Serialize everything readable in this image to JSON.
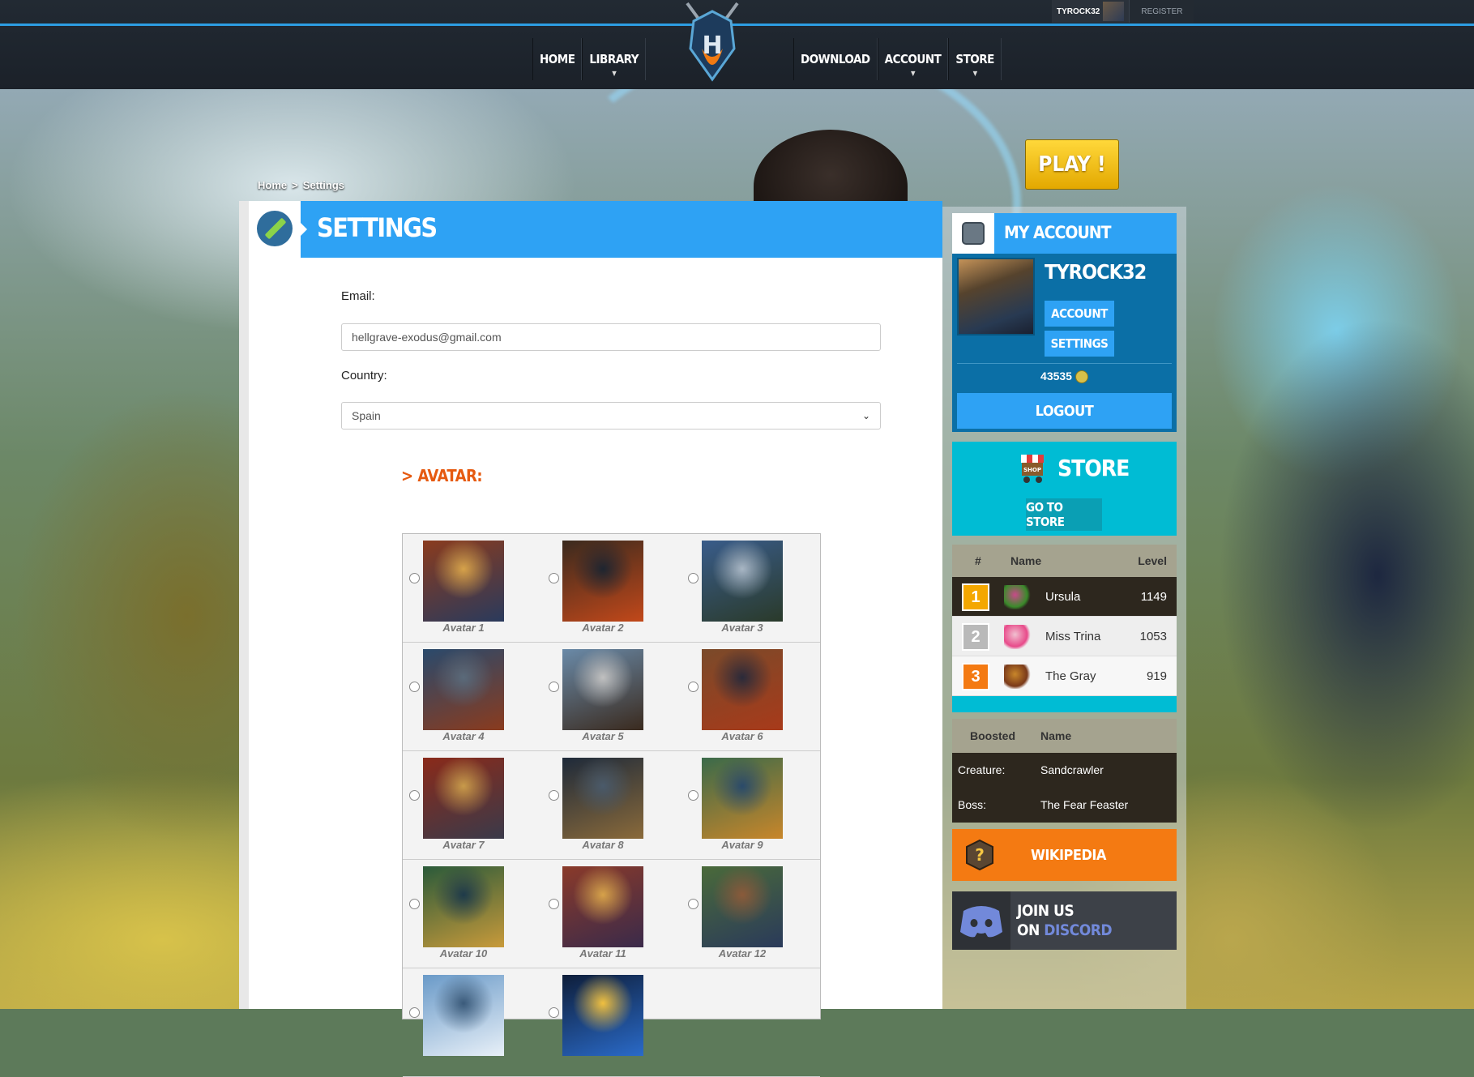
{
  "header": {
    "username": "TYROCK32",
    "register": "REGISTER",
    "nav_left": [
      "HOME",
      "LIBRARY"
    ],
    "nav_right": [
      "DOWNLOAD",
      "ACCOUNT",
      "STORE"
    ],
    "logo_letter": "H"
  },
  "breadcrumb": {
    "home": "Home",
    "sep": ">",
    "current": "Settings"
  },
  "play_label": "PLAY !",
  "settings": {
    "title": "SETTINGS",
    "email_label": "Email:",
    "email_value": "hellgrave-exodus@gmail.com",
    "country_label": "Country:",
    "country_value": "Spain",
    "avatar_label": "> AVATAR:",
    "avatars": [
      "Avatar 1",
      "Avatar 2",
      "Avatar 3",
      "Avatar 4",
      "Avatar 5",
      "Avatar 6",
      "Avatar 7",
      "Avatar 8",
      "Avatar 9",
      "Avatar 10",
      "Avatar 11",
      "Avatar 12",
      "",
      ""
    ]
  },
  "account": {
    "title": "MY ACCOUNT",
    "username": "TYROCK32",
    "account_btn": "ACCOUNT",
    "settings_btn": "SETTINGS",
    "coins": "43535",
    "logout": "LOGOUT"
  },
  "store": {
    "title": "STORE",
    "button": "GO TO STORE",
    "badge": "SHOP"
  },
  "ranking": {
    "headers": [
      "#",
      "Name",
      "Level"
    ],
    "rows": [
      {
        "rank": "1",
        "name": "Ursula",
        "level": "1149",
        "color": "#f4a700"
      },
      {
        "rank": "2",
        "name": "Miss Trina",
        "level": "1053",
        "color": "#b9b9b9"
      },
      {
        "rank": "3",
        "name": "The Gray",
        "level": "919",
        "color": "#f47a12"
      }
    ]
  },
  "boosted": {
    "headers": [
      "Boosted",
      "Name"
    ],
    "rows": [
      {
        "label": "Creature:",
        "name": "Sandcrawler"
      },
      {
        "label": "Boss:",
        "name": "The Fear Feaster"
      }
    ]
  },
  "wiki": {
    "title": "WIKIPEDIA",
    "icon": "?"
  },
  "discord": {
    "line1": "JOIN US",
    "line2_prefix": "ON",
    "line2_brand": "DISCORD"
  },
  "colors": {
    "accent": "#2ea2f4",
    "store": "#00bcd4",
    "wiki": "#f47a12",
    "play": "#f5c400"
  }
}
